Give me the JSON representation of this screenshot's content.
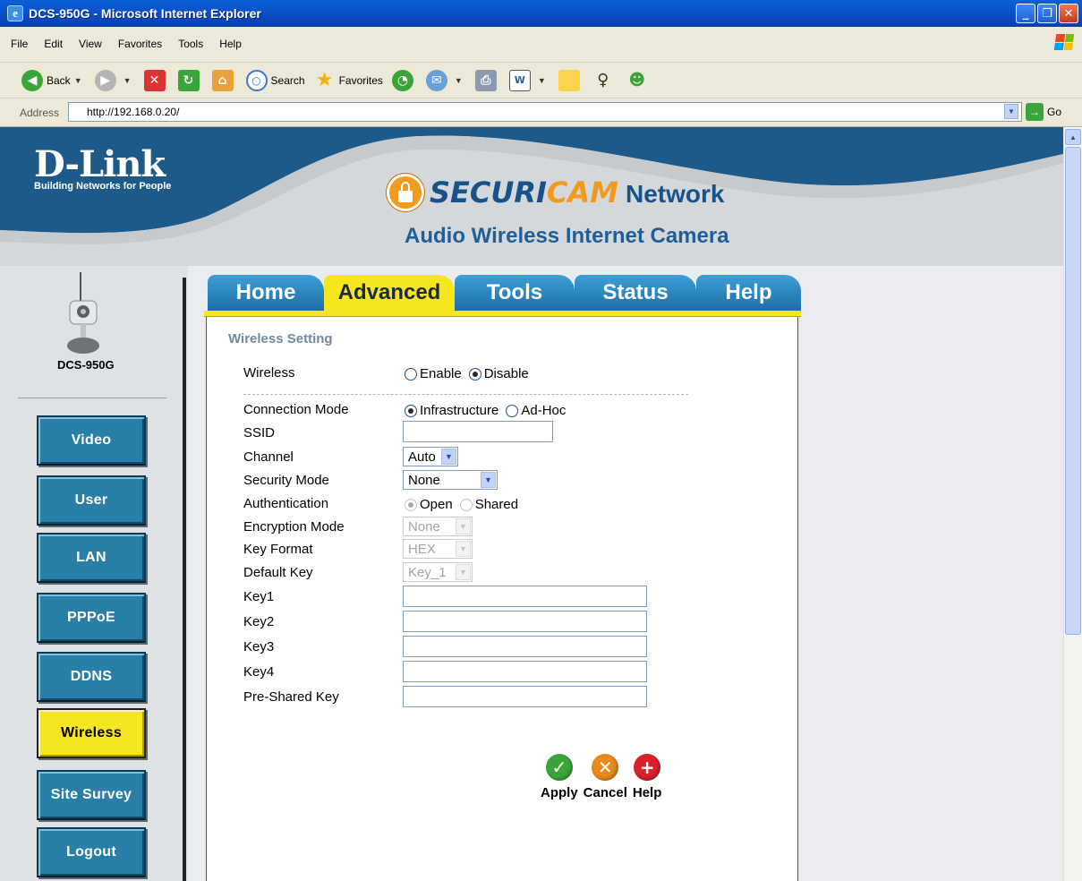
{
  "window": {
    "title": "DCS-950G - Microsoft Internet Explorer"
  },
  "menu": [
    "File",
    "Edit",
    "View",
    "Favorites",
    "Tools",
    "Help"
  ],
  "toolbar": {
    "back": "Back",
    "search": "Search",
    "favorites": "Favorites"
  },
  "address": {
    "label": "Address",
    "url": "http://192.168.0.20/",
    "go": "Go"
  },
  "brand": {
    "logo": "D-Link",
    "tagline": "Building Networks for People",
    "product_a": "SECURI",
    "product_b": "CAM",
    "product_c": "Network",
    "subtitle": "Audio Wireless Internet Camera"
  },
  "camera": {
    "model": "DCS-950G"
  },
  "nav": [
    {
      "label": "Video",
      "active": false
    },
    {
      "label": "User",
      "active": false
    },
    {
      "label": "LAN",
      "active": false
    },
    {
      "label": "PPPoE",
      "active": false
    },
    {
      "label": "DDNS",
      "active": false
    },
    {
      "label": "Wireless",
      "active": true
    },
    {
      "label": "Site Survey",
      "active": false
    },
    {
      "label": "Logout",
      "active": false
    }
  ],
  "tabs": [
    "Home",
    "Advanced",
    "Tools",
    "Status",
    "Help"
  ],
  "active_tab": "Advanced",
  "form": {
    "title": "Wireless Setting",
    "wireless": {
      "label": "Wireless",
      "opt1": "Enable",
      "opt2": "Disable",
      "selected": "Disable"
    },
    "connection_mode": {
      "label": "Connection Mode",
      "opt1": "Infrastructure",
      "opt2": "Ad-Hoc",
      "selected": "Infrastructure"
    },
    "ssid": {
      "label": "SSID",
      "value": ""
    },
    "channel": {
      "label": "Channel",
      "value": "Auto"
    },
    "security_mode": {
      "label": "Security Mode",
      "value": "None"
    },
    "authentication": {
      "label": "Authentication",
      "opt1": "Open",
      "opt2": "Shared",
      "selected": "Open"
    },
    "encryption_mode": {
      "label": "Encryption Mode",
      "value": "None"
    },
    "key_format": {
      "label": "Key Format",
      "value": "HEX"
    },
    "default_key": {
      "label": "Default Key",
      "value": "Key_1"
    },
    "key1": {
      "label": "Key1",
      "value": ""
    },
    "key2": {
      "label": "Key2",
      "value": ""
    },
    "key3": {
      "label": "Key3",
      "value": ""
    },
    "key4": {
      "label": "Key4",
      "value": ""
    },
    "psk": {
      "label": "Pre-Shared Key",
      "value": ""
    }
  },
  "actions": {
    "apply": "Apply",
    "cancel": "Cancel",
    "help": "Help"
  },
  "colors": {
    "nav_active": "#f5e61f",
    "nav": "#2a7fa8",
    "tab": "#2a86c2",
    "banner_blue": "#17538a"
  }
}
